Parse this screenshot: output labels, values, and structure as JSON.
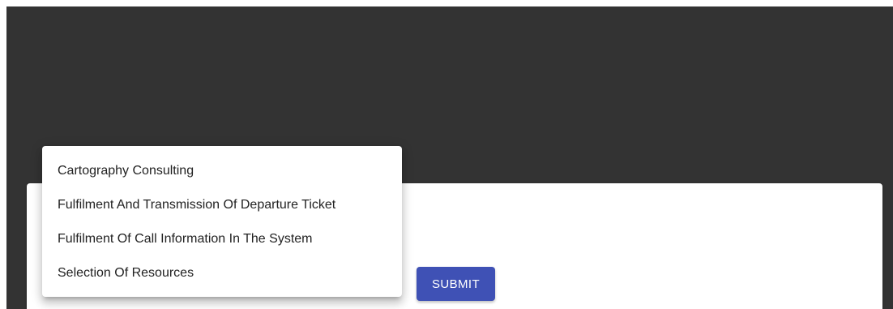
{
  "dropdown": {
    "options": [
      "Cartography Consulting",
      "Fulfilment And Transmission Of Departure Ticket",
      "Fulfilment Of Call Information In The System",
      "Selection Of Resources"
    ]
  },
  "form": {
    "submit_label": "SUBMIT",
    "submit_color": "#3f51b5"
  },
  "colors": {
    "backdrop": "#333333",
    "card": "#ffffff"
  }
}
